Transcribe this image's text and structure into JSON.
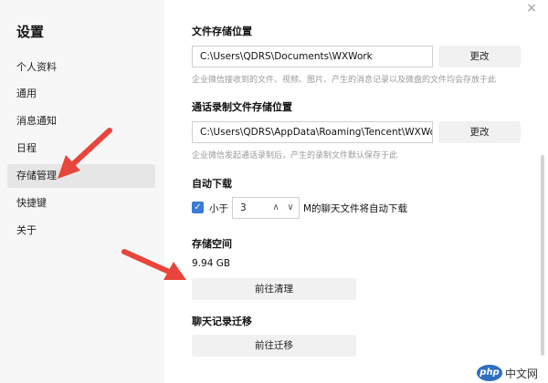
{
  "window": {
    "close_glyph": "×"
  },
  "sidebar": {
    "title": "设置",
    "items": [
      {
        "label": "个人资料"
      },
      {
        "label": "通用"
      },
      {
        "label": "消息通知"
      },
      {
        "label": "日程"
      },
      {
        "label": "存储管理",
        "active": true
      },
      {
        "label": "快捷键"
      },
      {
        "label": "关于"
      }
    ]
  },
  "file_storage": {
    "label": "文件存储位置",
    "path": "C:\\Users\\QDRS\\Documents\\WXWork",
    "change_label": "更改",
    "hint": "企业微信接收到的文件、视频、图片、产生的消息记录以及微盘的文件均会存放于此"
  },
  "call_storage": {
    "label": "通话录制文件存储位置",
    "path": "C:\\Users\\QDRS\\AppData\\Roaming\\Tencent\\WXWork...",
    "change_label": "更改",
    "hint": "企业微信发起通话录制后，产生的录制文件默认保存于此"
  },
  "auto_download": {
    "label": "自动下载",
    "checked": true,
    "prefix": "小于",
    "value": "3",
    "suffix": "M的聊天文件将自动下载"
  },
  "storage_space": {
    "label": "存储空间",
    "size": "9.94 GB",
    "clean_label": "前往清理"
  },
  "chat_migration": {
    "label": "聊天记录迁移",
    "migrate_label": "前往迁移"
  },
  "watermark": {
    "logo": "php",
    "text": "中文网"
  },
  "colors": {
    "arrow": "#e8453c",
    "accent": "#3a7bd5"
  }
}
